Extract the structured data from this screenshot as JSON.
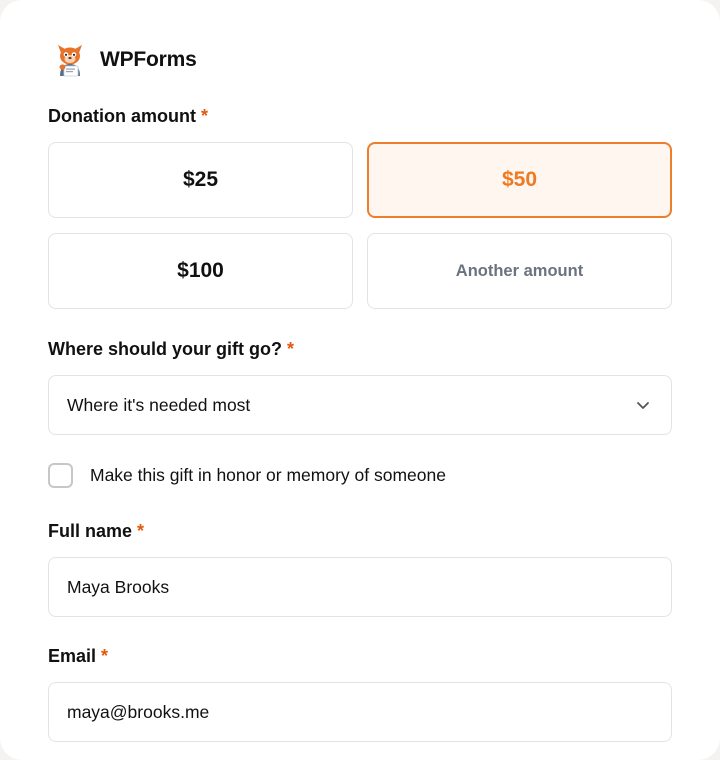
{
  "brand": {
    "name": "WPForms",
    "logo_icon": "wpforms-bear-icon"
  },
  "colors": {
    "accent": "#ee7a24",
    "required": "#e4570c",
    "selected_bg": "#fff6ef"
  },
  "donation": {
    "label": "Donation amount",
    "required": "*",
    "options": [
      {
        "label": "$25",
        "selected": false
      },
      {
        "label": "$50",
        "selected": true
      },
      {
        "label": "$100",
        "selected": false
      },
      {
        "label": "Another amount",
        "selected": false
      }
    ]
  },
  "gift": {
    "label": "Where should your gift go?",
    "required": "*",
    "selected": "Where it's needed most",
    "icon": "chevron-down-icon"
  },
  "honor": {
    "label": "Make this gift in honor or memory of someone",
    "checked": false
  },
  "full_name": {
    "label": "Full name",
    "required": "*",
    "value": "Maya Brooks"
  },
  "email": {
    "label": "Email",
    "required": "*",
    "value": "maya@brooks.me"
  }
}
